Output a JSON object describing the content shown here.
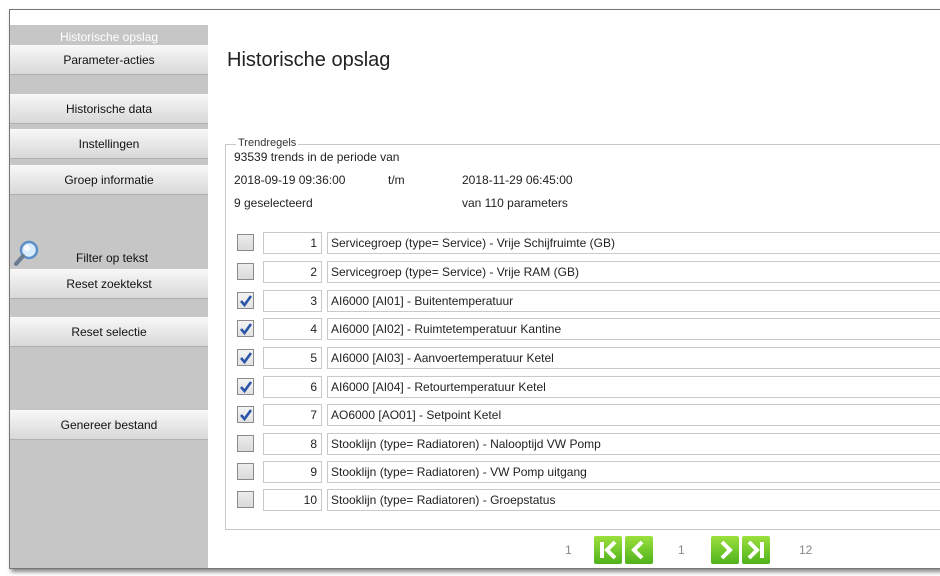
{
  "sidebar": {
    "header": "Historische opslag",
    "buttons": {
      "parameter_acties": "Parameter-acties",
      "historische_data": "Historische data",
      "instellingen": "Instellingen",
      "groep_informatie": "Groep informatie",
      "filter_op_tekst": "Filter op tekst",
      "reset_zoektekst": "Reset zoektekst",
      "reset_selectie": "Reset selectie",
      "genereer_bestand": "Genereer bestand"
    }
  },
  "main": {
    "title": "Historische opslag",
    "trend": {
      "legend": "Trendregels",
      "summary": "93539 trends in de periode van",
      "start": "2018-09-19 09:36:00",
      "tm": "t/m",
      "end": "2018-11-29 06:45:00",
      "selected": "9 geselecteerd",
      "of_params": "van 110 parameters"
    },
    "rows": [
      {
        "num": "1",
        "text": "Servicegroep (type= Service)  - Vrije Schijfruimte (GB)",
        "checked": false
      },
      {
        "num": "2",
        "text": "Servicegroep (type= Service)  - Vrije RAM (GB)",
        "checked": false
      },
      {
        "num": "3",
        "text": "AI6000 [AI01] - Buitentemperatuur",
        "checked": true
      },
      {
        "num": "4",
        "text": "AI6000 [AI02] - Ruimtetemperatuur Kantine",
        "checked": true
      },
      {
        "num": "5",
        "text": "AI6000 [AI03] - Aanvoertemperatuur Ketel",
        "checked": true
      },
      {
        "num": "6",
        "text": "AI6000 [AI04] - Retourtemperatuur Ketel",
        "checked": true
      },
      {
        "num": "7",
        "text": "AO6000 [AO01] - Setpoint Ketel",
        "checked": true
      },
      {
        "num": "8",
        "text": "Stooklijn (type= Radiatoren)  - Nalooptijd VW Pomp",
        "checked": false
      },
      {
        "num": "9",
        "text": "Stooklijn (type= Radiatoren)  - VW Pomp uitgang",
        "checked": false
      },
      {
        "num": "10",
        "text": "Stooklijn (type= Radiatoren)  - Groepstatus",
        "checked": false
      }
    ],
    "pager": {
      "first_page": "1",
      "current_page": "1",
      "last_page": "12"
    }
  },
  "colors": {
    "sidebar_bg": "#c6c6c6",
    "pager_green": "#4fb21c",
    "check_blue": "#2a55a8"
  },
  "icons": [
    "magnifier-icon",
    "first-page-icon",
    "previous-page-icon",
    "next-page-icon",
    "last-page-icon",
    "checkmark-icon"
  ]
}
